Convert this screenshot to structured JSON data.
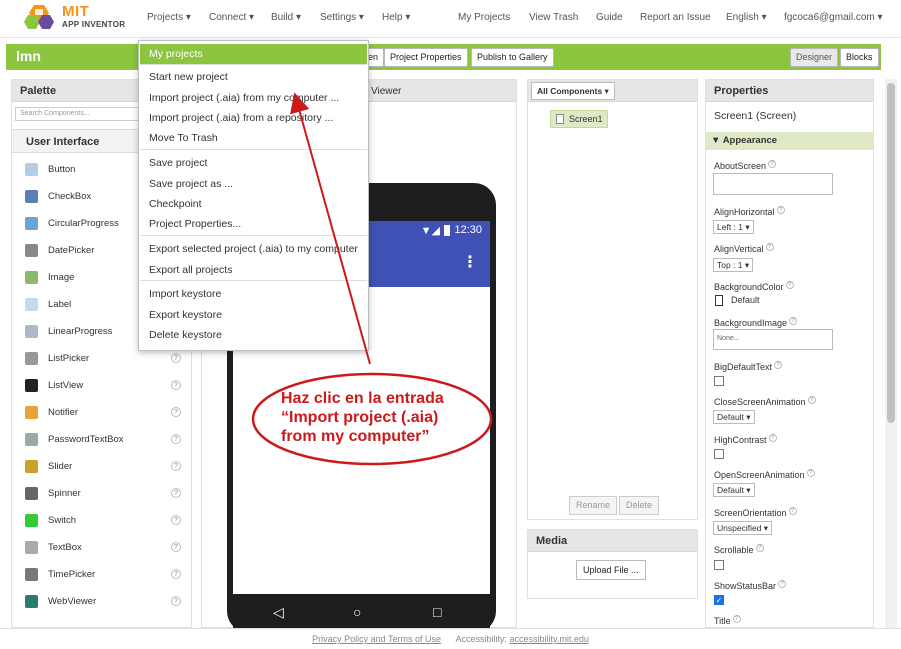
{
  "brand": {
    "line1": "MIT",
    "line2": "APP INVENTOR"
  },
  "nav": {
    "projects": "Projects ▾",
    "connect": "Connect ▾",
    "build": "Build ▾",
    "settings": "Settings ▾",
    "help": "Help ▾",
    "my_projects": "My Projects",
    "view_trash": "View Trash",
    "guide": "Guide",
    "report": "Report an Issue",
    "language": "English ▾",
    "account": "fgcoca6@gmail.com ▾"
  },
  "projbar": {
    "name": "lmn",
    "partial_btn": "en",
    "project_properties": "Project Properties",
    "publish": "Publish to Gallery",
    "designer": "Designer",
    "blocks": "Blocks"
  },
  "project_menu": {
    "items": [
      "My projects",
      "Start new project",
      "Import project (.aia) from my computer ...",
      "Import project (.aia) from a repository ...",
      "Move To Trash",
      "Save project",
      "Save project as ...",
      "Checkpoint",
      "Project Properties...",
      "Export selected project (.aia) to my computer",
      "Export all projects",
      "Import keystore",
      "Export keystore",
      "Delete keystore"
    ]
  },
  "palette": {
    "title": "Palette",
    "search_placeholder": "Search Components...",
    "section": "User Interface",
    "help_glyph": "?",
    "items": [
      "Button",
      "CheckBox",
      "CircularProgress",
      "DatePicker",
      "Image",
      "Label",
      "LinearProgress",
      "ListPicker",
      "ListView",
      "Notifier",
      "PasswordTextBox",
      "Slider",
      "Spinner",
      "Switch",
      "TextBox",
      "TimePicker",
      "WebViewer"
    ]
  },
  "viewer": {
    "title_partial": "Viewer",
    "time": "12:30",
    "menu_glyph": "⋮",
    "nav_back": "◁",
    "nav_home": "○",
    "nav_recent": "□"
  },
  "components": {
    "all_components": "All Components ▾",
    "screen1": "Screen1",
    "rename": "Rename",
    "delete": "Delete"
  },
  "media": {
    "title": "Media",
    "upload": "Upload File ..."
  },
  "properties": {
    "title": "Properties",
    "component": "Screen1 (Screen)",
    "group": "▼ Appearance",
    "help_glyph": "?",
    "about_screen": "AboutScreen",
    "align_horizontal": "AlignHorizontal",
    "align_horizontal_value": "Left : 1 ▾",
    "align_vertical": "AlignVertical",
    "align_vertical_value": "Top : 1 ▾",
    "background_color": "BackgroundColor",
    "background_color_value": "Default",
    "background_image": "BackgroundImage",
    "background_image_value": "None...",
    "big_default_text": "BigDefaultText",
    "close_screen_animation": "CloseScreenAnimation",
    "close_screen_animation_value": "Default ▾",
    "high_contrast": "HighContrast",
    "open_screen_animation": "OpenScreenAnimation",
    "open_screen_animation_value": "Default ▾",
    "screen_orientation": "ScreenOrientation",
    "screen_orientation_value": "Unspecified ▾",
    "scrollable": "Scrollable",
    "show_status_bar": "ShowStatusBar",
    "check_glyph": "✓",
    "title_label": "Title"
  },
  "footer": {
    "privacy": "Privacy Policy and Terms of Use",
    "accessibility_label": "Accessibility:",
    "accessibility_link": "accessibility.mit.edu"
  },
  "annotation": {
    "line1": "Haz clic en la entrada",
    "line2": "“Import project (.aia)",
    "line3": "from my computer”"
  },
  "colors": {
    "brand_green": "#8cc63f",
    "annotation_red": "#cc1a1a",
    "phone_blue": "#3f51b5"
  }
}
